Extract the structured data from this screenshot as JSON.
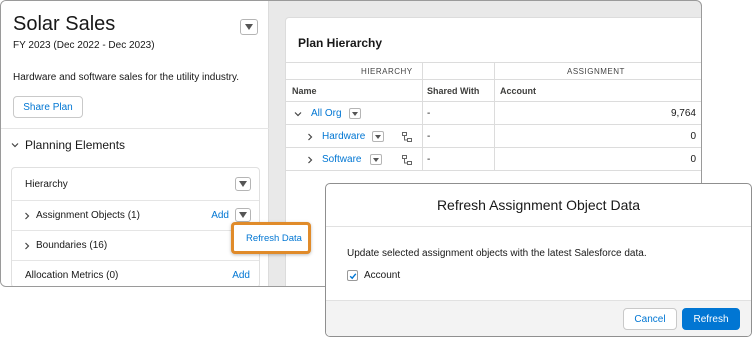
{
  "app": {
    "title": "Solar Sales",
    "subtitle": "FY 2023 (Dec 2022 - Dec 2023)",
    "description": "Hardware and software sales for the utility industry.",
    "share_label": "Share Plan"
  },
  "planning_elements": {
    "header": "Planning Elements",
    "rows": [
      {
        "label": "Hierarchy"
      },
      {
        "label": "Assignment Objects (1)",
        "action": "Add"
      },
      {
        "label": "Boundaries (16)",
        "action": "A"
      },
      {
        "label": "Allocation Metrics (0)",
        "action": "Add"
      }
    ],
    "popup_item": "Refresh Data"
  },
  "plan_hierarchy": {
    "title": "Plan Hierarchy",
    "groups": [
      "HIERARCHY",
      "ASSIGNMENT"
    ],
    "columns": [
      "Name",
      "Shared With",
      "Account"
    ],
    "rows": [
      {
        "name": "All Org",
        "shared": "-",
        "account": "9,764"
      },
      {
        "name": "Hardware",
        "shared": "-",
        "account": "0"
      },
      {
        "name": "Software",
        "shared": "-",
        "account": "0"
      }
    ]
  },
  "modal": {
    "title": "Refresh Assignment Object Data",
    "text": "Update selected assignment objects with the latest Salesforce data.",
    "checkbox_label": "Account",
    "checkbox_checked": true,
    "cancel_label": "Cancel",
    "refresh_label": "Refresh"
  },
  "colors": {
    "link_blue": "#0176d3",
    "highlight_orange": "#e08b2a",
    "panel_gray": "#e9e9e9"
  }
}
